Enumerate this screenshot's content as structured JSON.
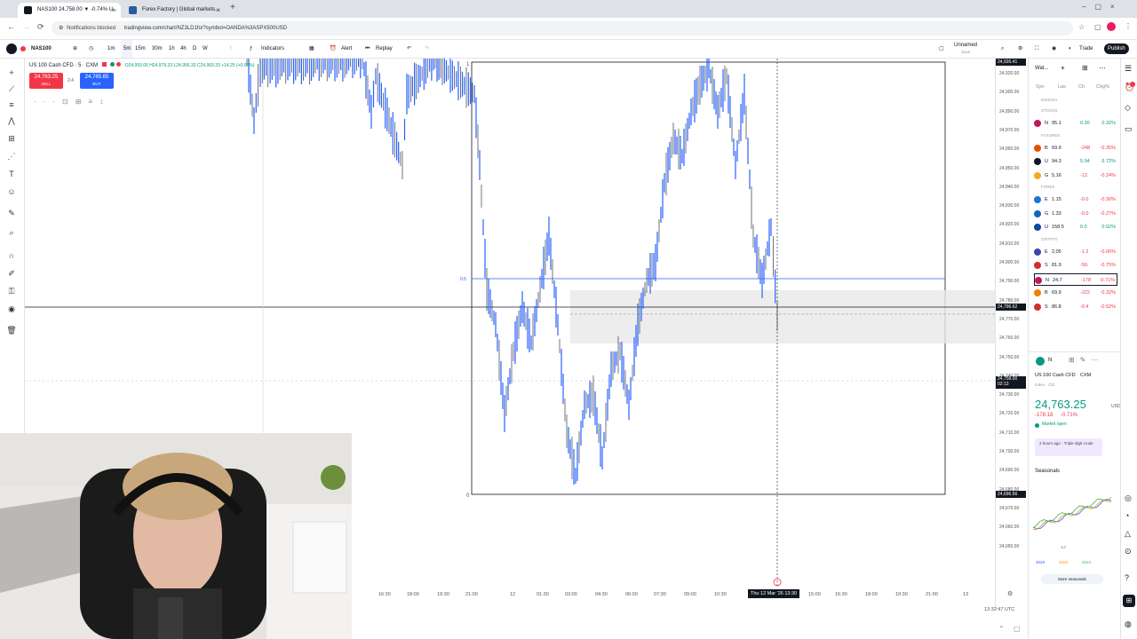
{
  "browser": {
    "tabs": [
      {
        "title": "NAS100 24,758.00 ▼ -0.74% U...",
        "active": true
      },
      {
        "title": "Forex Factory | Global markets...",
        "active": false
      }
    ],
    "notification": "Notifications blocked",
    "url": "tradingview.com/chart/NZ3LD1fo/?symbol=OANDA%3ASPX500USD"
  },
  "toolbar": {
    "symbol": "NAS100",
    "intervals": [
      "1m",
      "5m",
      "15m",
      "30m",
      "1h",
      "4h",
      "D",
      "W"
    ],
    "indicators_label": "Indicators",
    "alert_label": "Alert",
    "replay_label": "Replay",
    "layout_label": "Unnamed",
    "layout_sub": "Save",
    "trade_label": "Trade",
    "publish_label": "Publish"
  },
  "legend": {
    "title": "US 100 Cash CFD · 5 · CXM",
    "ohlc": "O24,959.05 H24,979.33 L24,956.33 C24,969.33 +14.25 (+0.06%)",
    "sell_price": "24,763.25",
    "sell_label": "SELL",
    "spread": "2.4",
    "buy_price": "24,765.65",
    "buy_label": "BUY"
  },
  "price_axis": {
    "labels": [
      "24,920.00",
      "24,900.00",
      "24,890.00",
      "24,870.00",
      "24,860.00",
      "24,850.00",
      "24,840.00",
      "24,830.00",
      "24,820.00",
      "24,810.00",
      "24,800.00",
      "24,790.00",
      "24,780.00",
      "24,770.00",
      "24,760.00",
      "24,750.00",
      "24,740.00",
      "24,730.00",
      "24,720.00",
      "24,710.00",
      "24,700.00",
      "24,690.00",
      "24,680.00",
      "24,670.00",
      "24,660.00",
      "24,650.00"
    ],
    "top_tag": "24,926.41",
    "crosshair_tag": "24,796.62",
    "last_tag": "24,758.00",
    "last_timer": "02:13",
    "bottom_tag": "24,696.56"
  },
  "time_axis": {
    "labels": [
      "16:30",
      "18:00",
      "19:30",
      "21:00",
      "12",
      "01:30",
      "03:00",
      "04:30",
      "06:00",
      "07:30",
      "09:00",
      "10:30",
      "15:00",
      "16:30",
      "18:00",
      "19:30",
      "21:00",
      "13"
    ],
    "crosshair_label": "Thu 12 Mar '26  13:30",
    "clock": "13:32:47 UTC"
  },
  "fib_labels": {
    "one": "1",
    "half": "0.5",
    "zero": "0"
  },
  "watchlist": {
    "title": "Wat...",
    "columns": [
      "Syn",
      "Las",
      "Ch",
      "Chg%"
    ],
    "sections": [
      {
        "name": "INDICES",
        "rows": []
      },
      {
        "name": "STOCKS",
        "rows": [
          {
            "sym": "N",
            "last": "95.1",
            "chg": "0.30",
            "pct": "0.32%",
            "color": "#c2185b",
            "dir": "up"
          }
        ]
      },
      {
        "name": "FUTURES",
        "rows": [
          {
            "sym": "B",
            "last": "69.9",
            "chg": "-248",
            "pct": "-0.35%",
            "color": "#e65100",
            "dir": "down"
          },
          {
            "sym": "U",
            "last": "94.3",
            "chg": "5.94",
            "pct": "6.72%",
            "color": "#131722",
            "dir": "up"
          },
          {
            "sym": "G",
            "last": "5,16",
            "chg": "-12.",
            "pct": "-0.24%",
            "color": "#f9a825",
            "dir": "down"
          }
        ]
      },
      {
        "name": "FOREX",
        "rows": [
          {
            "sym": "E",
            "last": "1.15",
            "chg": "-0.0",
            "pct": "-0.30%",
            "color": "#1976d2",
            "dir": "down"
          },
          {
            "sym": "G",
            "last": "1.33",
            "chg": "-0.0",
            "pct": "-0.27%",
            "color": "#1565c0",
            "dir": "down"
          },
          {
            "sym": "U",
            "last": "158.5",
            "chg": "0.0",
            "pct": "0.02%",
            "color": "#0d47a1",
            "dir": "up"
          }
        ]
      },
      {
        "name": "CRYPTO",
        "rows": [
          {
            "sym": "E",
            "last": "2,05",
            "chg": "-1.2",
            "pct": "-0.06%",
            "color": "#3949ab",
            "dir": "down"
          },
          {
            "sym": "S",
            "last": "81.9",
            "chg": "-50.",
            "pct": "-0.75%",
            "color": "#d32f2f",
            "dir": "down"
          },
          {
            "sym": "N",
            "last": "24,7",
            "chg": "-178",
            "pct": "-0.71%",
            "color": "#c2185b",
            "dir": "down"
          },
          {
            "sym": "B",
            "last": "69,9",
            "chg": "-222",
            "pct": "-0.32%",
            "color": "#f57c00",
            "dir": "down"
          },
          {
            "sym": "S",
            "last": "86.8",
            "chg": "-0.4",
            "pct": "-0.52%",
            "color": "#d32f2f",
            "dir": "down"
          }
        ]
      }
    ]
  },
  "details": {
    "symbol": "N",
    "name": "US 100 Cash CFD",
    "exchange": "CXM",
    "type": "Index · Cfd",
    "price": "24,763.25",
    "currency": "USD",
    "change": "-178.18",
    "change_pct": "-0.71%",
    "market_status": "Market open",
    "news": "2 hours ago · Triple digit crude",
    "seasonals_title": "Seasonals",
    "seasonals_legend": [
      "2026",
      "2025",
      "2024"
    ],
    "seasonals_month": "Jul",
    "more_label": "More seasonals"
  },
  "colors": {
    "candle": "#2962ff",
    "down": "#f23645",
    "up": "#089981",
    "accent": "#2962ff"
  }
}
